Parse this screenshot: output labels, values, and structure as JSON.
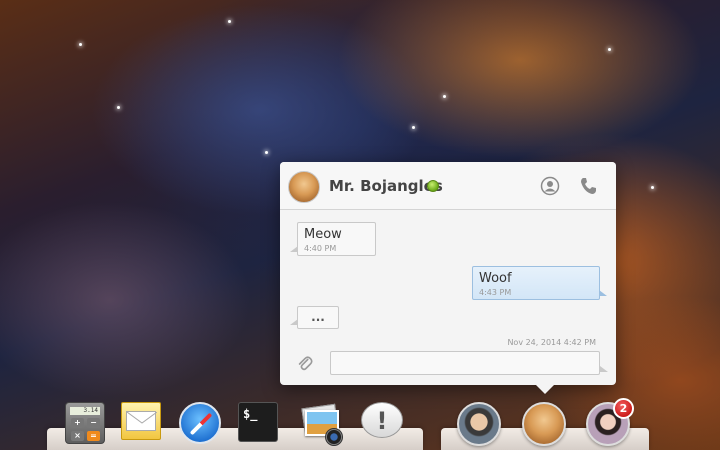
{
  "chat": {
    "contact_name": "Mr. Bojangles",
    "status": "online",
    "messages": [
      {
        "text": "Meow",
        "time": "4:40 PM",
        "direction": "incoming"
      },
      {
        "text": "Woof",
        "time": "4:43 PM",
        "direction": "outgoing"
      }
    ],
    "typing_indicator": "...",
    "date_stamp": "Nov 24, 2014 4:42 PM",
    "compose_value": "",
    "icons": {
      "profile": "user-profile-icon",
      "call": "phone-icon",
      "attach": "paperclip-icon"
    }
  },
  "dock": {
    "apps": [
      {
        "name": "calculator",
        "icon": "calculator-icon",
        "display": "3.14"
      },
      {
        "name": "mail",
        "icon": "mail-icon"
      },
      {
        "name": "safari",
        "icon": "compass-icon"
      },
      {
        "name": "terminal",
        "icon": "terminal-icon",
        "glyph": "$_"
      },
      {
        "name": "photos",
        "icon": "photos-icon"
      },
      {
        "name": "notifications",
        "icon": "exclamation-bubble-icon",
        "glyph": "!"
      }
    ],
    "contacts": [
      {
        "name": "contact-1"
      },
      {
        "name": "contact-2",
        "active": true
      },
      {
        "name": "contact-3",
        "unread": "2"
      }
    ]
  },
  "colors": {
    "online_status": "#7cc22a",
    "badge": "#d92a2a",
    "outgoing_bubble": "#d8e9f8",
    "incoming_bubble": "#f8f8f8"
  }
}
